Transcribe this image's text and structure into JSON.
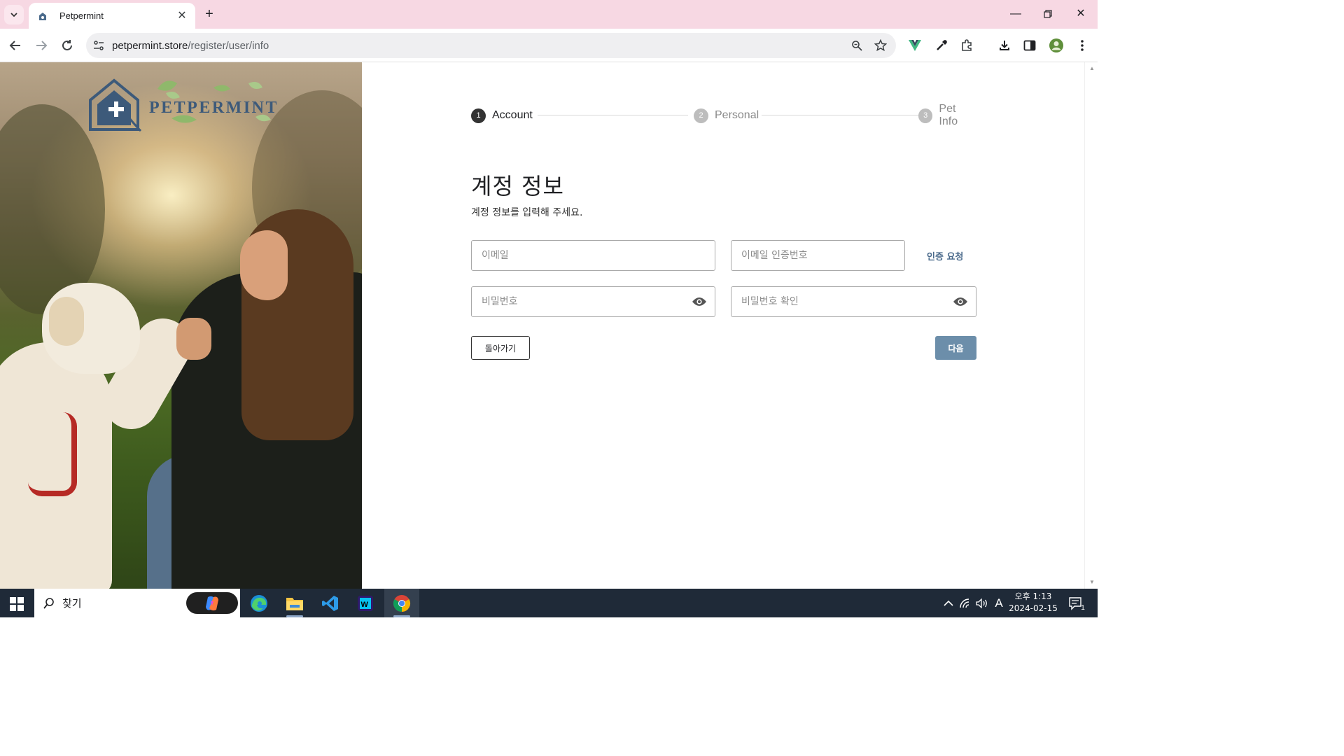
{
  "browser": {
    "tab_title": "Petpermint",
    "url_domain": "petpermint.store",
    "url_path": "/register/user/info"
  },
  "logo": {
    "wordmark": "PETPERMINT"
  },
  "stepper": {
    "steps": [
      {
        "num": "1",
        "label": "Account",
        "active": true
      },
      {
        "num": "2",
        "label": "Personal",
        "active": false
      },
      {
        "num": "3",
        "label": "Pet Info",
        "active": false
      }
    ]
  },
  "form": {
    "title": "계정 정보",
    "subtitle": "계정 정보를 입력해 주세요.",
    "email_placeholder": "이메일",
    "code_placeholder": "이메일 인증번호",
    "verify_label": "인증 요청",
    "password_placeholder": "비밀번호",
    "password_confirm_placeholder": "비밀번호 확인",
    "back_label": "돌아가기",
    "next_label": "다음"
  },
  "taskbar": {
    "search_label": "찾기",
    "time": "오후 1:13",
    "date": "2024-02-15",
    "notification_count": "1",
    "ime": "A"
  },
  "colors": {
    "tabstrip": "#f7d8e3",
    "accent_button": "#6c8eaa",
    "link": "#4b6b8c",
    "step_active": "#333333",
    "step_inactive": "#bdbdbd"
  }
}
